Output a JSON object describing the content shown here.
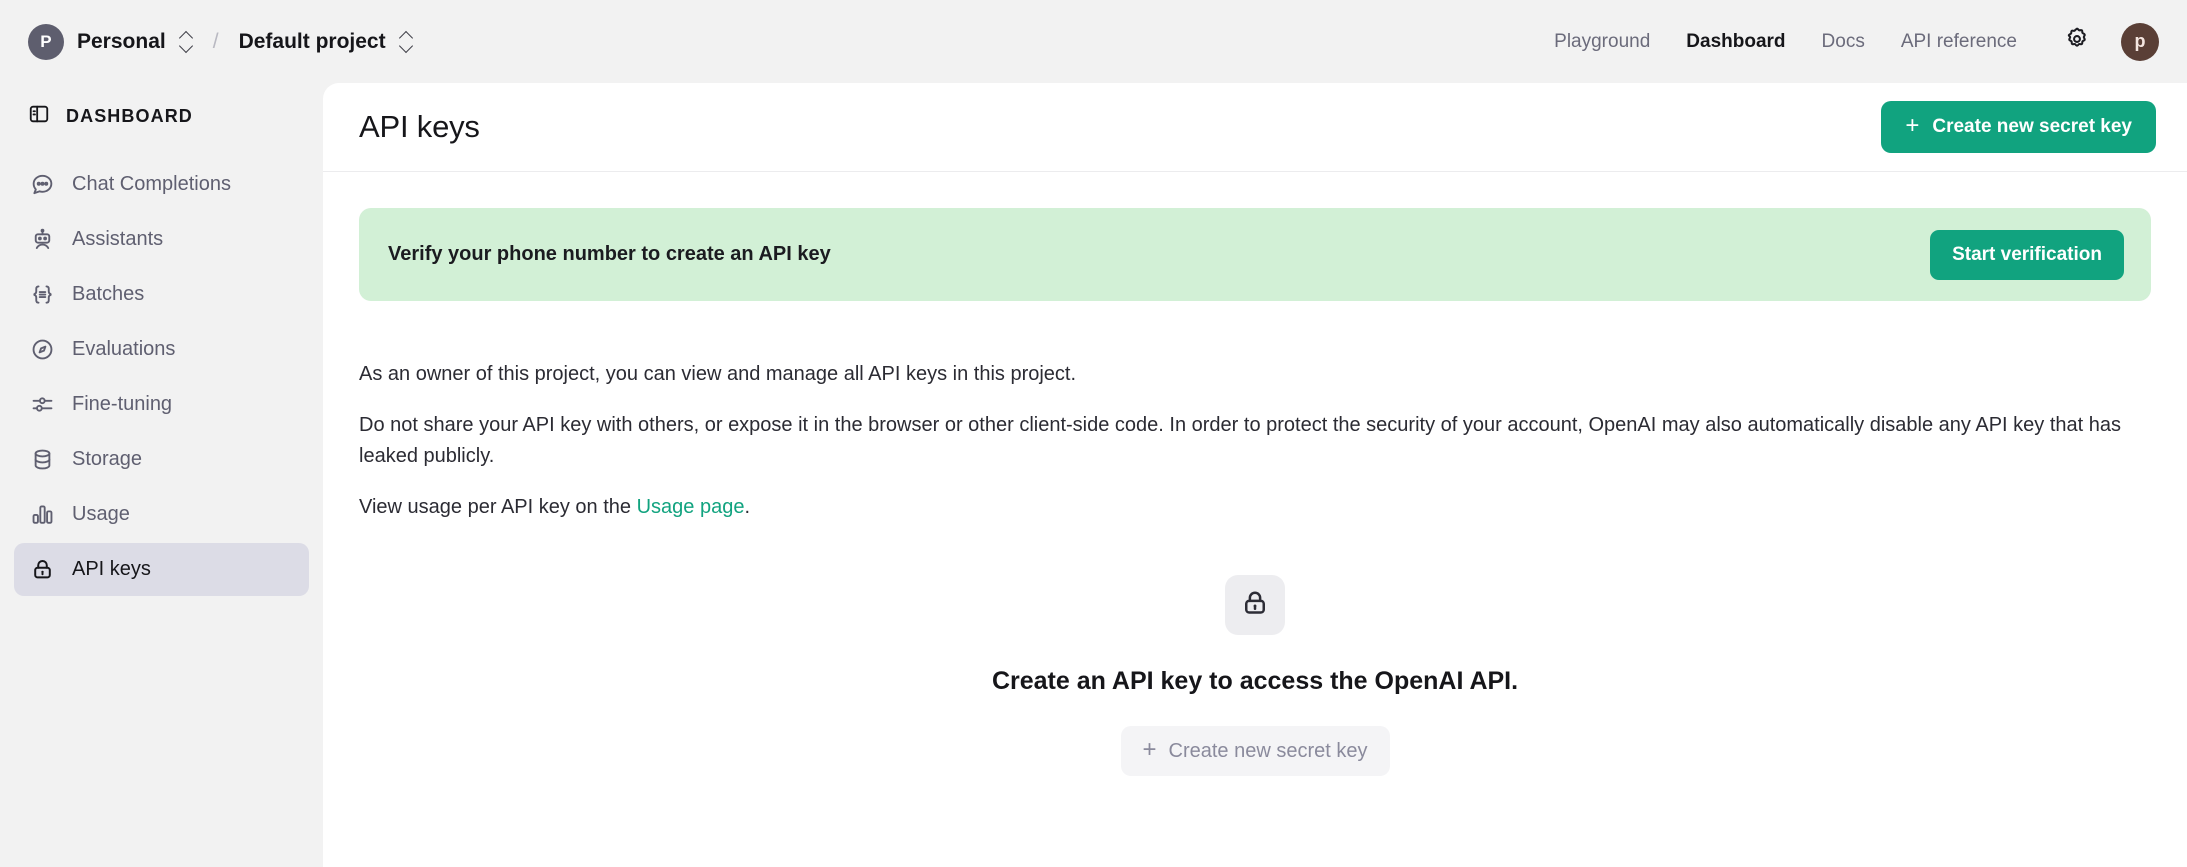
{
  "topbar": {
    "org": {
      "avatar_initial": "P",
      "name": "Personal",
      "switcher_icon": "chevron-up-down-icon"
    },
    "separator": "/",
    "project": {
      "name": "Default project",
      "switcher_icon": "chevron-up-down-icon"
    },
    "nav": [
      {
        "label": "Playground",
        "active": false
      },
      {
        "label": "Dashboard",
        "active": true
      },
      {
        "label": "Docs",
        "active": false
      },
      {
        "label": "API reference",
        "active": false
      }
    ],
    "settings_icon": "gear-icon",
    "user_avatar_initial": "p"
  },
  "sidebar": {
    "header": {
      "label": "DASHBOARD",
      "icon": "panel-layout-icon"
    },
    "items": [
      {
        "label": "Chat Completions",
        "icon": "chat-bubble-icon",
        "active": false
      },
      {
        "label": "Assistants",
        "icon": "robot-icon",
        "active": false
      },
      {
        "label": "Batches",
        "icon": "braces-list-icon",
        "active": false
      },
      {
        "label": "Evaluations",
        "icon": "compass-icon",
        "active": false
      },
      {
        "label": "Fine-tuning",
        "icon": "sliders-icon",
        "active": false
      },
      {
        "label": "Storage",
        "icon": "database-icon",
        "active": false
      },
      {
        "label": "Usage",
        "icon": "bar-chart-icon",
        "active": false
      },
      {
        "label": "API keys",
        "icon": "lock-icon",
        "active": true
      }
    ]
  },
  "main": {
    "title": "API keys",
    "create_button": {
      "label": "Create new secret key",
      "icon": "plus-icon"
    },
    "banner": {
      "message": "Verify your phone number to create an API key",
      "action_label": "Start verification"
    },
    "description": {
      "paragraph1": "As an owner of this project, you can view and manage all API keys in this project.",
      "paragraph2": "Do not share your API key with others, or expose it in the browser or other client-side code. In order to protect the security of your account, OpenAI may also automatically disable any API key that has leaked publicly.",
      "paragraph3_prefix": "View usage per API key on the ",
      "paragraph3_link": "Usage page",
      "paragraph3_suffix": "."
    },
    "empty_state": {
      "icon": "lock-icon",
      "title": "Create an API key to access the OpenAI API.",
      "button_label": "Create new secret key",
      "button_icon": "plus-icon"
    }
  },
  "colors": {
    "accent_green": "#11a37f",
    "banner_bg": "#d2f0d6",
    "page_bg": "#f2f2f2",
    "card_bg": "#ffffff",
    "active_nav_bg": "#dcdce6"
  }
}
